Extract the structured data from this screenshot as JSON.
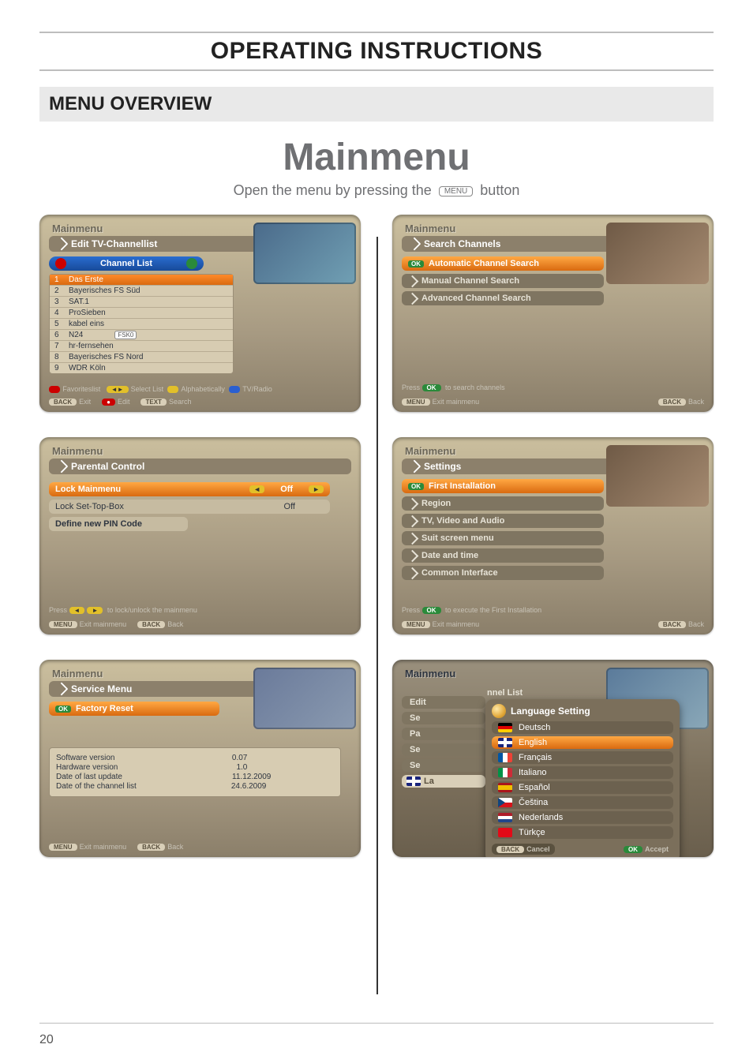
{
  "page": {
    "title": "OPERATING INSTRUCTIONS",
    "section": "MENU OVERVIEW",
    "number": "20"
  },
  "main": {
    "title": "Mainmenu",
    "sub_pre": "Open the menu by pressing the ",
    "btn": "MENU",
    "sub_post": " button"
  },
  "p1": {
    "mm": "Mainmenu",
    "sub": "Edit TV-Channellist",
    "pill": "Channel List",
    "rows": [
      {
        "n": "1",
        "name": "Das Erste"
      },
      {
        "n": "2",
        "name": "Bayerisches FS Süd"
      },
      {
        "n": "3",
        "name": "SAT.1"
      },
      {
        "n": "4",
        "name": "ProSieben"
      },
      {
        "n": "5",
        "name": "kabel eins"
      },
      {
        "n": "6",
        "name": "N24"
      },
      {
        "n": "7",
        "name": "hr-fernsehen"
      },
      {
        "n": "8",
        "name": "Bayerisches FS Nord"
      },
      {
        "n": "9",
        "name": "WDR Köln"
      }
    ],
    "fsk": "FSK0",
    "leg_fav": "Favoriteslist",
    "leg_sel": "Select List",
    "leg_alpha": "Alphabetically",
    "leg_tv": "TV/Radio",
    "b_back": "BACK",
    "f_exit": "Exit",
    "b_red": "●",
    "f_edit": "Edit",
    "b_txt": "TEXT",
    "f_search": "Search"
  },
  "p2": {
    "mm": "Mainmenu",
    "sub": "Search Channels",
    "i1": "Automatic Channel Search",
    "i2": "Manual Channel Search",
    "i3": "Advanced Channel Search",
    "hint_pre": "Press ",
    "hint_ok": "OK",
    "hint_post": " to search channels",
    "b_menu": "MENU",
    "f_exit": "Exit mainmenu",
    "b_back": "BACK",
    "f_back": "Back"
  },
  "p3": {
    "mm": "Mainmenu",
    "sub": "Parental Control",
    "r1": "Lock Mainmenu",
    "r1v": "Off",
    "r2": "Lock Set-Top-Box",
    "r2v": "Off",
    "r3": "Define new PIN Code",
    "hint_pre": "Press ",
    "hint_mid": " to lock/unlock the mainmenu",
    "b_menu": "MENU",
    "f_exit": "Exit mainmenu",
    "b_back": "BACK",
    "f_back": "Back",
    "arrL": "◄",
    "arrR": "►"
  },
  "p4": {
    "mm": "Mainmenu",
    "sub": "Settings",
    "i1": "First Installation",
    "i2": "Region",
    "i3": "TV, Video and Audio",
    "i4": "Suit screen menu",
    "i5": "Date and time",
    "i6": "Common Interface",
    "hint_pre": "Press ",
    "hint_ok": "OK",
    "hint_post": " to execute the First Installation",
    "b_menu": "MENU",
    "f_exit": "Exit mainmenu",
    "b_back": "BACK",
    "f_back": "Back"
  },
  "p5": {
    "mm": "Mainmenu",
    "sub": "Service Menu",
    "i1": "Factory Reset",
    "info": {
      "sw_l": "Software version",
      "sw_v": "0.07",
      "hw_l": "Hardware version",
      "hw_v": "1.0",
      "du_l": "Date of last update",
      "du_v": "11.12.2009",
      "dc_l": "Date of the channel list",
      "dc_v": "24.6.2009"
    },
    "b_menu": "MENU",
    "f_exit": "Exit mainmenu",
    "b_back": "BACK",
    "f_back": "Back"
  },
  "p6": {
    "mm": "Mainmenu",
    "bg_ed": "Edit ",
    "bg_ed2": "nnel List",
    "bg_se": "Se",
    "bg_pa": "Pa",
    "bg_se2": "Se",
    "bg_se3": "Se",
    "bg_la": "La",
    "pop": "Language Setting",
    "langs": [
      {
        "f": "f-de",
        "n": "Deutsch"
      },
      {
        "f": "f-en",
        "n": "English"
      },
      {
        "f": "f-fr",
        "n": "Français"
      },
      {
        "f": "f-it",
        "n": "Italiano"
      },
      {
        "f": "f-es",
        "n": "Español"
      },
      {
        "f": "f-cz",
        "n": "Čeština"
      },
      {
        "f": "f-nl",
        "n": "Nederlands"
      },
      {
        "f": "f-tr",
        "n": "Türkçe"
      }
    ],
    "b_back": "BACK",
    "f_cancel": "Cancel",
    "b_ok": "OK",
    "f_accept": "Accept"
  }
}
